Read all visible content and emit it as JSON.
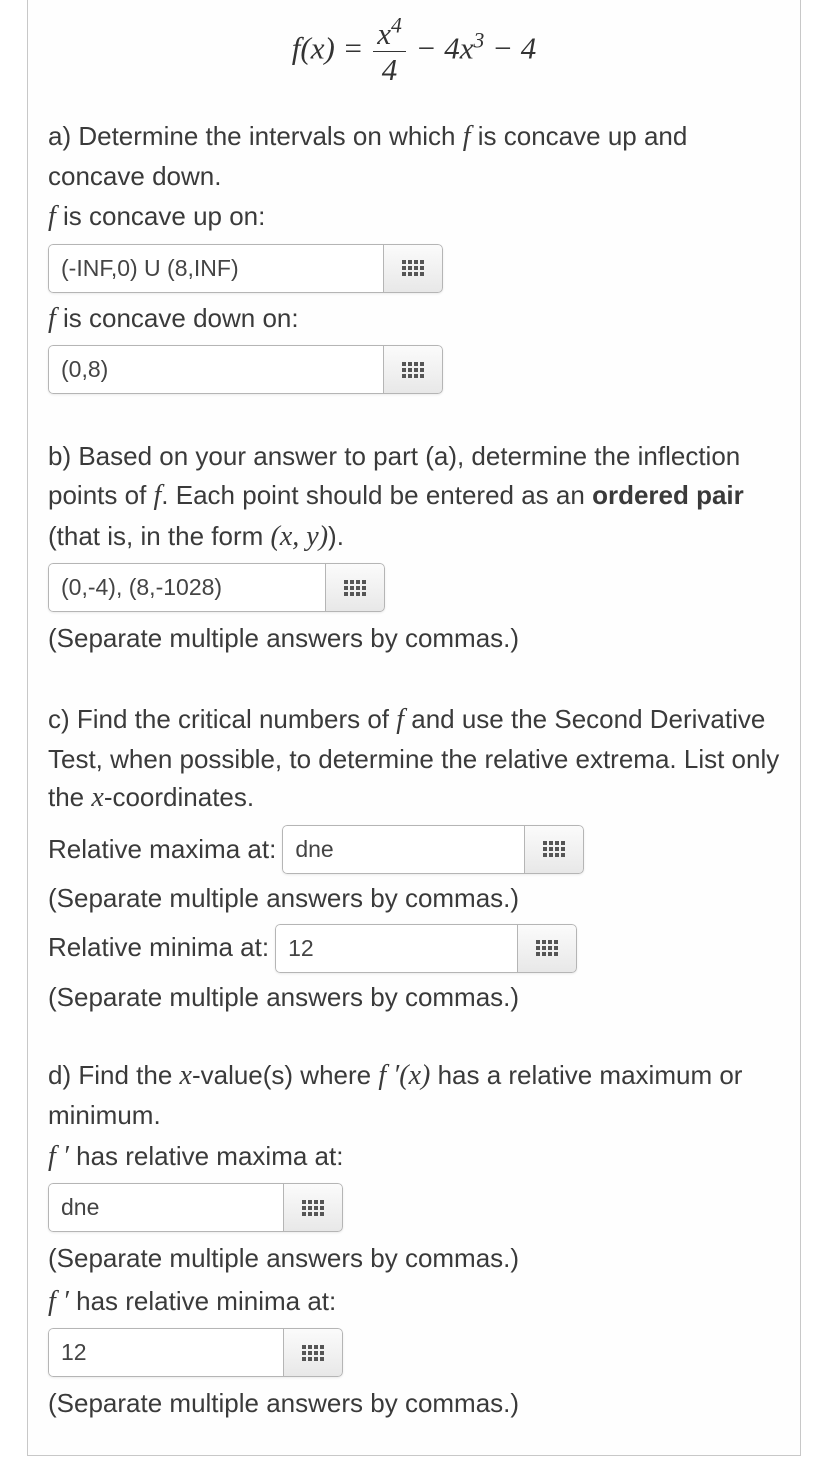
{
  "formula": {
    "lhs": "f(x) =",
    "frac_num": "x⁴",
    "frac_den": "4",
    "tail": "− 4x³ − 4"
  },
  "partA": {
    "prompt_pre": "a) Determine the intervals on which ",
    "prompt_post": " is concave up and concave down.",
    "concave_up_label_pre": "f",
    "concave_up_label_post": " is concave up on:",
    "concave_up_value": "(-INF,0) U (8,INF)",
    "concave_down_label_pre": "f",
    "concave_down_label_post": " is concave down on:",
    "concave_down_value": "(0,8)"
  },
  "partB": {
    "prompt_line1": "b) Based on your answer to part (a), determine the inflection points of ",
    "prompt_line1_post": ". Each point should be entered as an ",
    "ordered_pair": "ordered pair",
    "prompt_tail": " (that is, in the form ",
    "xy": "(x, y)",
    "close": ").",
    "value": "(0,-4), (8,-1028)",
    "sep_after": "(Separate multiple answers by commas.)"
  },
  "partC": {
    "prompt_pre": "c) Find the critical numbers of ",
    "prompt_mid": " and use the Second Derivative Test, when possible, to determine the relative extrema. List only the ",
    "xvar": "x",
    "prompt_post": "-coordinates.",
    "rel_max_label": "Relative maxima at:",
    "rel_max_value": "dne",
    "sep1": "(Separate multiple answers by commas.)",
    "rel_min_label": "Relative minima at:",
    "rel_min_value": "12",
    "sep2": "(Separate multiple answers by commas.)"
  },
  "partD": {
    "prompt_pre": "d) Find the ",
    "xvar": "x",
    "prompt_mid": "-value(s) where ",
    "fprime": "f ′(x)",
    "prompt_post": " has a relative maximum or minimum.",
    "max_label_pre": "f ′",
    "max_label_post": " has relative maxima at:",
    "max_value": "dne",
    "sep_after_max": "(Separate multiple answers by commas.)",
    "min_label_pre": "f ′",
    "min_label_post": " has relative minima at:",
    "min_value": "12",
    "sep_after_min": "(Separate multiple answers by commas.)"
  }
}
